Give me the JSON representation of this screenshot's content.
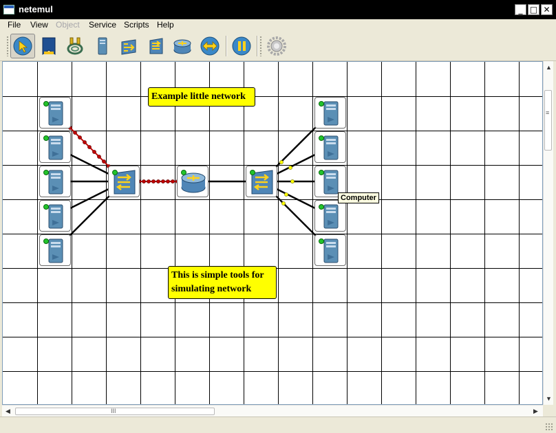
{
  "window": {
    "title": "netemul"
  },
  "title_buttons": {
    "minimize": "_",
    "maximize": "□",
    "close": "✕"
  },
  "menu": [
    {
      "label": "File",
      "enabled": true
    },
    {
      "label": "View",
      "enabled": true
    },
    {
      "label": "Object",
      "enabled": false
    },
    {
      "label": "Service",
      "enabled": true
    },
    {
      "label": "Scripts",
      "enabled": true
    },
    {
      "label": "Help",
      "enabled": true
    }
  ],
  "toolbar": [
    {
      "icon": "select-arrow-icon",
      "active": true
    },
    {
      "icon": "note-icon",
      "active": false
    },
    {
      "icon": "cable-icon",
      "active": false
    },
    {
      "icon": "computer-icon",
      "active": false
    },
    {
      "icon": "hub-icon",
      "active": false
    },
    {
      "icon": "switch-icon",
      "active": false
    },
    {
      "icon": "router-icon",
      "active": false
    },
    {
      "icon": "send-icon",
      "active": false
    },
    {
      "icon": "pause-icon",
      "active": false
    },
    {
      "icon": "settings-gear-icon",
      "active": false
    }
  ],
  "canvas": {
    "notes": [
      {
        "text": "Example little network"
      },
      {
        "line1": "This is simple tools for",
        "line2": "simulating network"
      }
    ],
    "tooltip": "Computer",
    "devices": [
      {
        "type": "computer",
        "id": "pc-left-1"
      },
      {
        "type": "computer",
        "id": "pc-left-2"
      },
      {
        "type": "computer",
        "id": "pc-left-3"
      },
      {
        "type": "computer",
        "id": "pc-left-4"
      },
      {
        "type": "computer",
        "id": "pc-left-5"
      },
      {
        "type": "switch",
        "id": "switch-left"
      },
      {
        "type": "router",
        "id": "router"
      },
      {
        "type": "switch",
        "id": "switch-right"
      },
      {
        "type": "computer",
        "id": "pc-right-1"
      },
      {
        "type": "computer",
        "id": "pc-right-2"
      },
      {
        "type": "computer",
        "id": "pc-right-3"
      },
      {
        "type": "computer",
        "id": "pc-right-4"
      },
      {
        "type": "computer",
        "id": "pc-right-5"
      }
    ],
    "colors": {
      "grid": "#000000",
      "note_bg": "#ffff00",
      "cable_active": "#c00000",
      "packet": "#ffff00",
      "link_led": "#22c42b"
    }
  },
  "scrollbars": {
    "grip": "III"
  }
}
